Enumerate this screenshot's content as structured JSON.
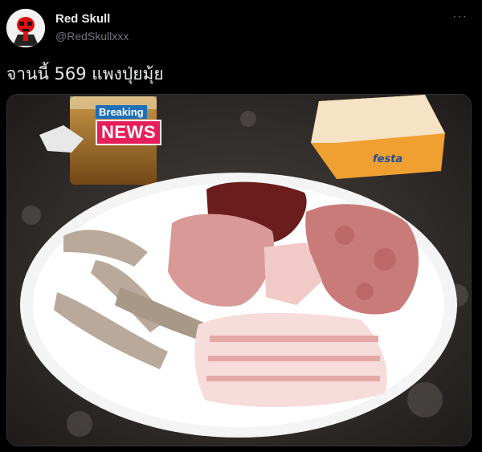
{
  "tweet": {
    "author_name": "Red Skull",
    "author_handle": "@RedSkullxxx",
    "more_icon": "···",
    "text": "จานนี้ 569 แพงปุ่ยมุ้ย"
  },
  "photo": {
    "badge_top": "Breaking",
    "badge_main": "NEWS",
    "napkin_brand": "festa",
    "colors": {
      "badge_top": "#1d6fb8",
      "badge_main": "#e61e5a"
    }
  }
}
